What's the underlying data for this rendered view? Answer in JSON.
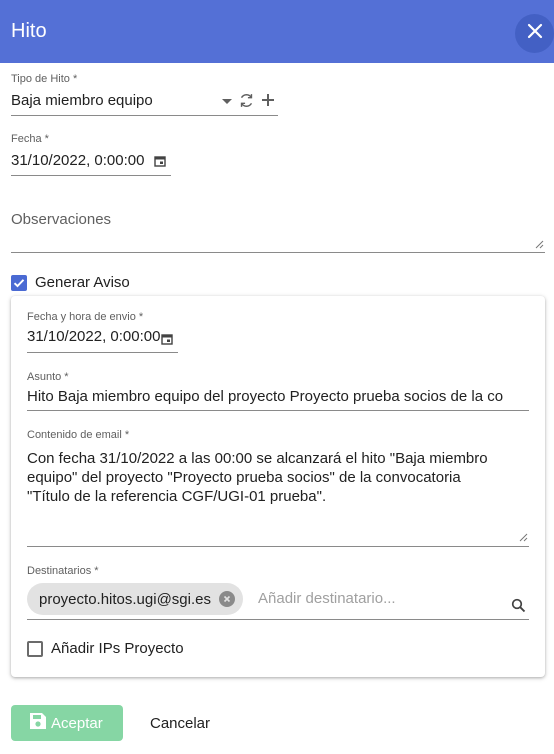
{
  "dialog": {
    "title": "Hito",
    "close_icon": "close-icon"
  },
  "form": {
    "tipo_hito": {
      "label": "Tipo de Hito *",
      "value": "Baja miembro equipo",
      "icons": [
        "chevron-down-icon",
        "refresh-icon",
        "add-icon"
      ]
    },
    "fecha": {
      "label": "Fecha *",
      "value": "31/10/2022, 0:00:00",
      "icon": "calendar-icon"
    },
    "observaciones": {
      "label": "Observaciones",
      "value": ""
    },
    "generar_aviso": {
      "label": "Generar Aviso",
      "checked": true
    }
  },
  "aviso": {
    "fecha_envio": {
      "label": "Fecha y hora de envio *",
      "value": "31/10/2022, 0:00:00",
      "icon": "calendar-icon"
    },
    "asunto": {
      "label": "Asunto *",
      "value": "Hito Baja miembro equipo del proyecto Proyecto prueba socios de la co"
    },
    "contenido": {
      "label": "Contenido de email *",
      "lines": [
        "Con fecha 31/10/2022 a las 00:00 se alcanzará el hito \"Baja miembro",
        "equipo\" del proyecto \"Proyecto prueba socios\" de la convocatoria",
        "\"Título de la referencia CGF/UGI-01 prueba\"."
      ]
    },
    "destinatarios": {
      "label": "Destinatarios *",
      "chips": [
        "proyecto.hitos.ugi@sgi.es"
      ],
      "placeholder": "Añadir destinatario...",
      "icon": "search-icon"
    },
    "anadir_ips": {
      "label": "Añadir IPs Proyecto",
      "checked": false
    }
  },
  "actions": {
    "accept_label": "Aceptar",
    "accept_icon": "save-icon",
    "cancel_label": "Cancelar"
  },
  "colors": {
    "header": "#5470d6",
    "accent": "#4a6ad3",
    "accept_disabled": "#86d6a4"
  }
}
